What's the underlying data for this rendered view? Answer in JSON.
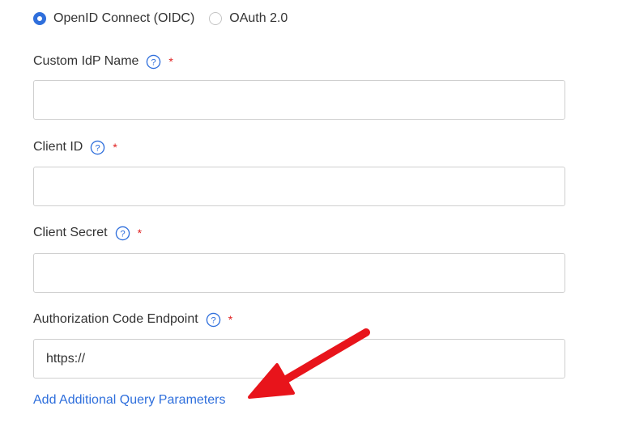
{
  "protocol": {
    "options": [
      {
        "label": "OpenID Connect (OIDC)",
        "selected": true
      },
      {
        "label": "OAuth 2.0",
        "selected": false
      }
    ]
  },
  "fields": {
    "idp_name": {
      "label": "Custom IdP Name",
      "value": "",
      "required_mark": "*"
    },
    "client_id": {
      "label": "Client ID",
      "value": "",
      "required_mark": "*"
    },
    "client_secret": {
      "label": "Client Secret",
      "value": "",
      "required_mark": "*"
    },
    "auth_endpoint": {
      "label": "Authorization Code Endpoint",
      "value": "https://",
      "required_mark": "*"
    }
  },
  "links": {
    "add_query_params": "Add Additional Query Parameters"
  },
  "icons": {
    "help": "question-circle-icon",
    "annotation": "red-arrow-icon"
  },
  "colors": {
    "accent": "#2f6fdc",
    "required": "#e02020",
    "annotation_arrow": "#e8141b",
    "text": "#333333",
    "input_border": "#cfcfcf"
  }
}
